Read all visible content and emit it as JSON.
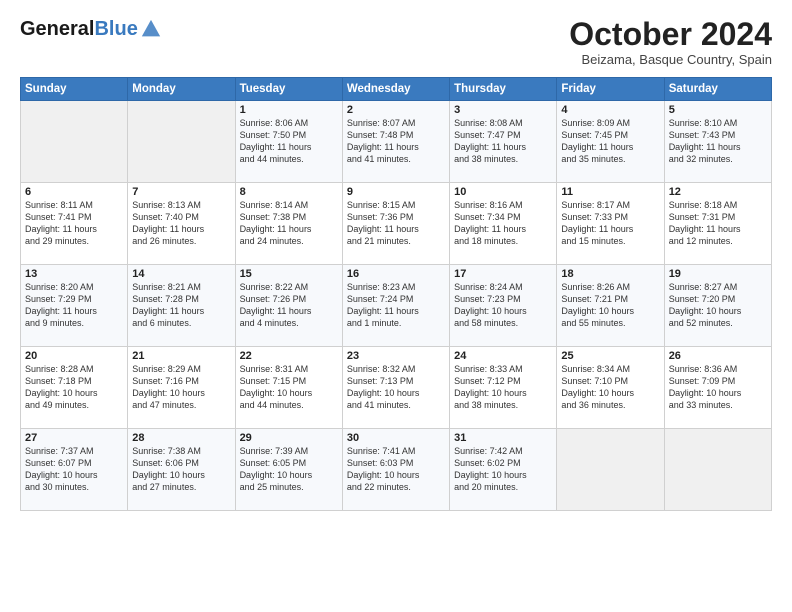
{
  "header": {
    "logo_line1": "General",
    "logo_line2": "Blue",
    "month": "October 2024",
    "location": "Beizama, Basque Country, Spain"
  },
  "weekdays": [
    "Sunday",
    "Monday",
    "Tuesday",
    "Wednesday",
    "Thursday",
    "Friday",
    "Saturday"
  ],
  "weeks": [
    [
      {
        "num": "",
        "detail": ""
      },
      {
        "num": "",
        "detail": ""
      },
      {
        "num": "1",
        "detail": "Sunrise: 8:06 AM\nSunset: 7:50 PM\nDaylight: 11 hours\nand 44 minutes."
      },
      {
        "num": "2",
        "detail": "Sunrise: 8:07 AM\nSunset: 7:48 PM\nDaylight: 11 hours\nand 41 minutes."
      },
      {
        "num": "3",
        "detail": "Sunrise: 8:08 AM\nSunset: 7:47 PM\nDaylight: 11 hours\nand 38 minutes."
      },
      {
        "num": "4",
        "detail": "Sunrise: 8:09 AM\nSunset: 7:45 PM\nDaylight: 11 hours\nand 35 minutes."
      },
      {
        "num": "5",
        "detail": "Sunrise: 8:10 AM\nSunset: 7:43 PM\nDaylight: 11 hours\nand 32 minutes."
      }
    ],
    [
      {
        "num": "6",
        "detail": "Sunrise: 8:11 AM\nSunset: 7:41 PM\nDaylight: 11 hours\nand 29 minutes."
      },
      {
        "num": "7",
        "detail": "Sunrise: 8:13 AM\nSunset: 7:40 PM\nDaylight: 11 hours\nand 26 minutes."
      },
      {
        "num": "8",
        "detail": "Sunrise: 8:14 AM\nSunset: 7:38 PM\nDaylight: 11 hours\nand 24 minutes."
      },
      {
        "num": "9",
        "detail": "Sunrise: 8:15 AM\nSunset: 7:36 PM\nDaylight: 11 hours\nand 21 minutes."
      },
      {
        "num": "10",
        "detail": "Sunrise: 8:16 AM\nSunset: 7:34 PM\nDaylight: 11 hours\nand 18 minutes."
      },
      {
        "num": "11",
        "detail": "Sunrise: 8:17 AM\nSunset: 7:33 PM\nDaylight: 11 hours\nand 15 minutes."
      },
      {
        "num": "12",
        "detail": "Sunrise: 8:18 AM\nSunset: 7:31 PM\nDaylight: 11 hours\nand 12 minutes."
      }
    ],
    [
      {
        "num": "13",
        "detail": "Sunrise: 8:20 AM\nSunset: 7:29 PM\nDaylight: 11 hours\nand 9 minutes."
      },
      {
        "num": "14",
        "detail": "Sunrise: 8:21 AM\nSunset: 7:28 PM\nDaylight: 11 hours\nand 6 minutes."
      },
      {
        "num": "15",
        "detail": "Sunrise: 8:22 AM\nSunset: 7:26 PM\nDaylight: 11 hours\nand 4 minutes."
      },
      {
        "num": "16",
        "detail": "Sunrise: 8:23 AM\nSunset: 7:24 PM\nDaylight: 11 hours\nand 1 minute."
      },
      {
        "num": "17",
        "detail": "Sunrise: 8:24 AM\nSunset: 7:23 PM\nDaylight: 10 hours\nand 58 minutes."
      },
      {
        "num": "18",
        "detail": "Sunrise: 8:26 AM\nSunset: 7:21 PM\nDaylight: 10 hours\nand 55 minutes."
      },
      {
        "num": "19",
        "detail": "Sunrise: 8:27 AM\nSunset: 7:20 PM\nDaylight: 10 hours\nand 52 minutes."
      }
    ],
    [
      {
        "num": "20",
        "detail": "Sunrise: 8:28 AM\nSunset: 7:18 PM\nDaylight: 10 hours\nand 49 minutes."
      },
      {
        "num": "21",
        "detail": "Sunrise: 8:29 AM\nSunset: 7:16 PM\nDaylight: 10 hours\nand 47 minutes."
      },
      {
        "num": "22",
        "detail": "Sunrise: 8:31 AM\nSunset: 7:15 PM\nDaylight: 10 hours\nand 44 minutes."
      },
      {
        "num": "23",
        "detail": "Sunrise: 8:32 AM\nSunset: 7:13 PM\nDaylight: 10 hours\nand 41 minutes."
      },
      {
        "num": "24",
        "detail": "Sunrise: 8:33 AM\nSunset: 7:12 PM\nDaylight: 10 hours\nand 38 minutes."
      },
      {
        "num": "25",
        "detail": "Sunrise: 8:34 AM\nSunset: 7:10 PM\nDaylight: 10 hours\nand 36 minutes."
      },
      {
        "num": "26",
        "detail": "Sunrise: 8:36 AM\nSunset: 7:09 PM\nDaylight: 10 hours\nand 33 minutes."
      }
    ],
    [
      {
        "num": "27",
        "detail": "Sunrise: 7:37 AM\nSunset: 6:07 PM\nDaylight: 10 hours\nand 30 minutes."
      },
      {
        "num": "28",
        "detail": "Sunrise: 7:38 AM\nSunset: 6:06 PM\nDaylight: 10 hours\nand 27 minutes."
      },
      {
        "num": "29",
        "detail": "Sunrise: 7:39 AM\nSunset: 6:05 PM\nDaylight: 10 hours\nand 25 minutes."
      },
      {
        "num": "30",
        "detail": "Sunrise: 7:41 AM\nSunset: 6:03 PM\nDaylight: 10 hours\nand 22 minutes."
      },
      {
        "num": "31",
        "detail": "Sunrise: 7:42 AM\nSunset: 6:02 PM\nDaylight: 10 hours\nand 20 minutes."
      },
      {
        "num": "",
        "detail": ""
      },
      {
        "num": "",
        "detail": ""
      }
    ]
  ]
}
